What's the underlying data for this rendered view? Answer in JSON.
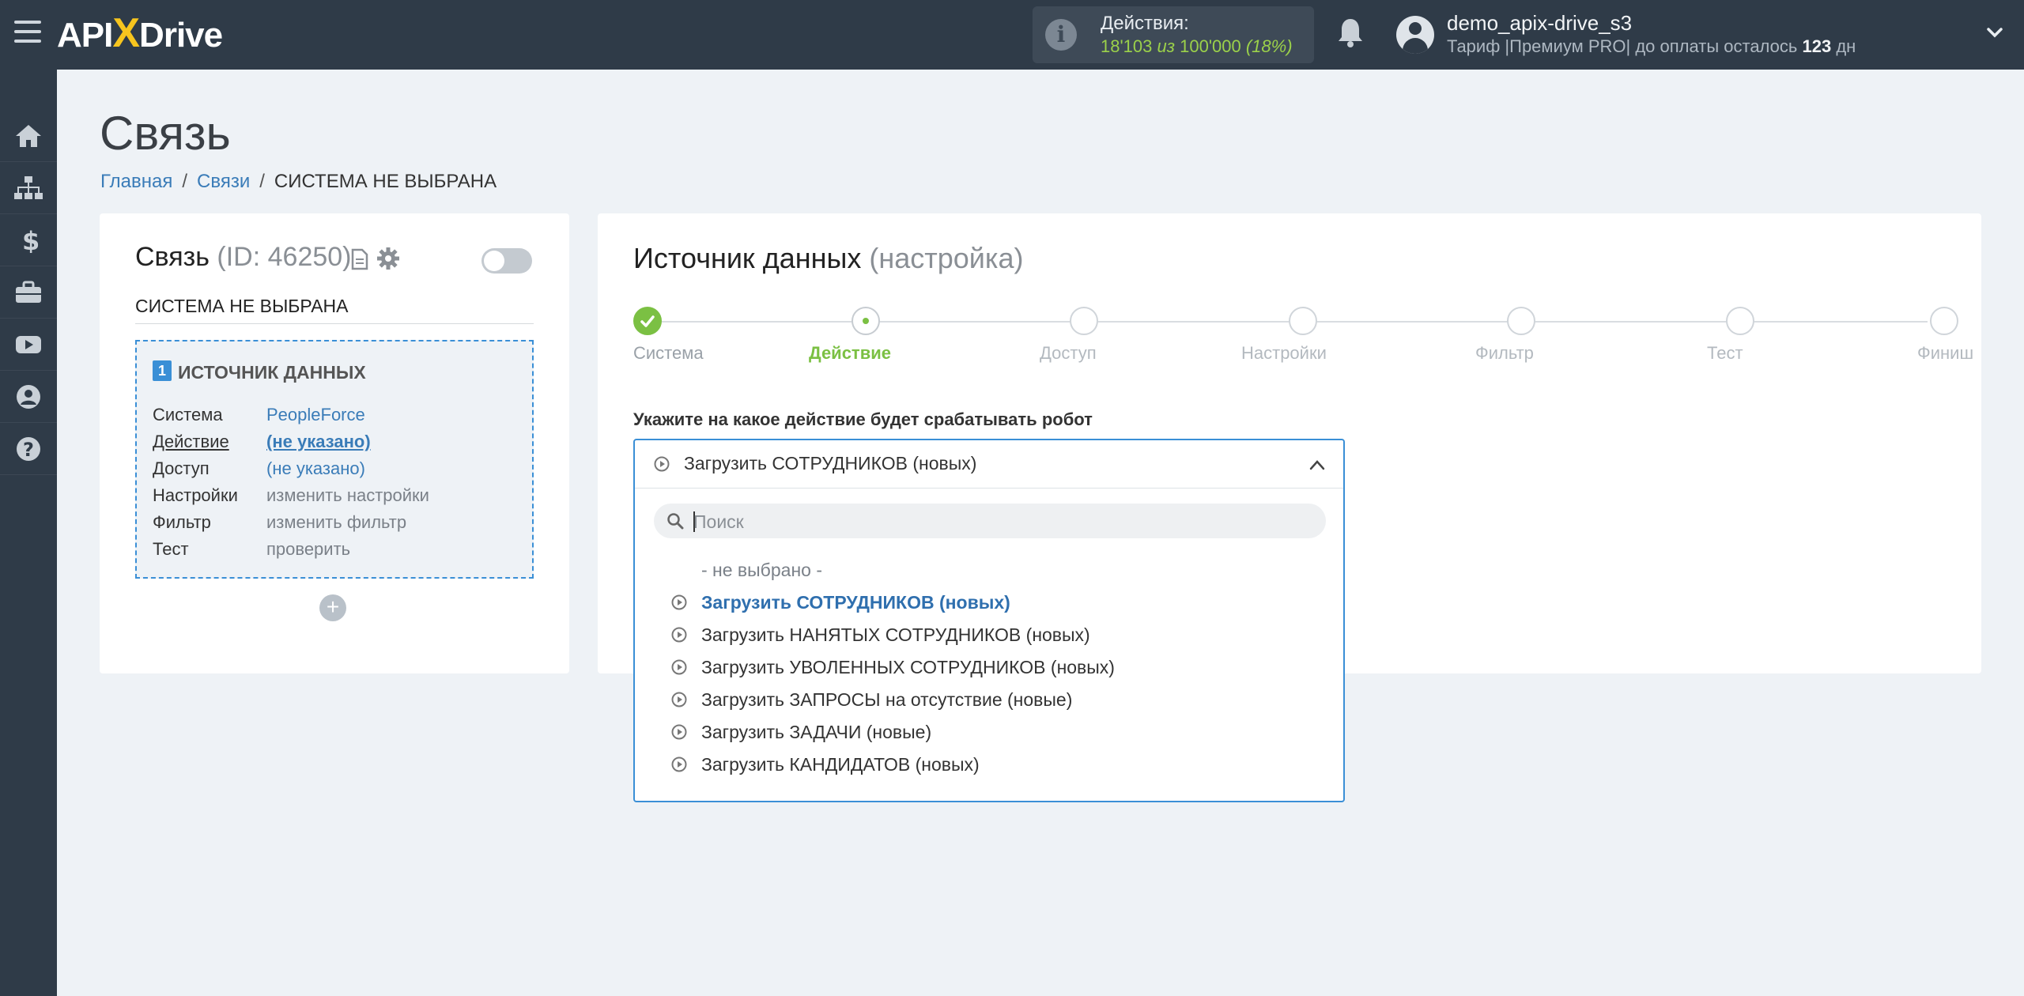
{
  "header": {
    "logo_text_api": "API",
    "logo_text_x": "X",
    "logo_text_drive": "Drive",
    "actions_label": "Действия:",
    "actions_used": "18'103",
    "actions_of": "из",
    "actions_total": "100'000",
    "actions_percent": "(18%)",
    "username": "demo_apix-drive_s3",
    "plan_prefix": "Тариф |Премиум PRO| до оплаты осталось",
    "plan_days": "123",
    "plan_suffix": "дн"
  },
  "sidebar": {
    "items": [
      {
        "icon": "home-icon"
      },
      {
        "icon": "sitemap-icon"
      },
      {
        "icon": "dollar-icon"
      },
      {
        "icon": "briefcase-icon"
      },
      {
        "icon": "youtube-icon"
      },
      {
        "icon": "user-circle-icon"
      },
      {
        "icon": "question-icon"
      }
    ]
  },
  "page": {
    "title": "Связь",
    "breadcrumb": {
      "home": "Главная",
      "links": "Связи",
      "current": "СИСТЕМА НЕ ВЫБРАНА"
    }
  },
  "connection": {
    "title": "Связь",
    "id_text": "(ID: 46250)",
    "system_name": "СИСТЕМА НЕ ВЫБРАНА",
    "source": {
      "number": "1",
      "title": "ИСТОЧНИК ДАННЫХ",
      "rows": [
        {
          "key": "Система",
          "value": "PeopleForce"
        },
        {
          "key": "Действие",
          "value": "(не указано)"
        },
        {
          "key": "Доступ",
          "value": "(не указано)"
        },
        {
          "key": "Настройки",
          "value": "изменить настройки"
        },
        {
          "key": "Фильтр",
          "value": "изменить фильтр"
        },
        {
          "key": "Тест",
          "value": "проверить"
        }
      ]
    },
    "add_label": "+"
  },
  "source_setup": {
    "title": "Источник данных",
    "subtitle": "(настройка)",
    "steps": [
      "Система",
      "Действие",
      "Доступ",
      "Настройки",
      "Фильтр",
      "Тест",
      "Финиш"
    ],
    "current_step": 1,
    "robot_label": "Укажите на какое действие будет срабатывать робот",
    "selected_value": "Загрузить СОТРУДНИКОВ (новых)",
    "search_placeholder": "Поиск",
    "options": [
      "- не выбрано -",
      "Загрузить СОТРУДНИКОВ (новых)",
      "Загрузить НАНЯТЫХ СОТРУДНИКОВ (новых)",
      "Загрузить УВОЛЕННЫХ СОТРУДНИКОВ (новых)",
      "Загрузить ЗАПРОСЫ на отсутствие (новые)",
      "Загрузить ЗАДАЧИ (новые)",
      "Загрузить КАНДИДАТОВ (новых)"
    ]
  },
  "colors": {
    "topbar": "#2f3b48",
    "accent_green": "#7bc043",
    "accent_blue": "#3a8fd6",
    "link_blue": "#3a7cb8"
  }
}
